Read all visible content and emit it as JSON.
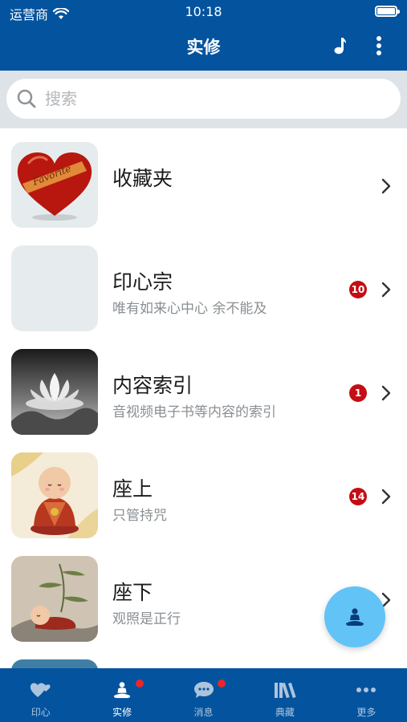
{
  "status": {
    "carrier": "运营商",
    "time": "10:18"
  },
  "nav": {
    "title": "实修",
    "music_icon": "music-note-icon",
    "more_icon": "more-vertical-icon"
  },
  "search": {
    "placeholder": "搜索",
    "value": ""
  },
  "items": [
    {
      "title": "收藏夹",
      "subtitle": "",
      "badge": "",
      "thumb": "favorite-heart"
    },
    {
      "title": "印心宗",
      "subtitle": "唯有如来心中心 余不能及",
      "badge": "10",
      "thumb": "blank"
    },
    {
      "title": "内容索引",
      "subtitle": "音视频电子书等内容的索引",
      "badge": "1",
      "thumb": "lotus"
    },
    {
      "title": "座上",
      "subtitle": "只管持咒",
      "badge": "14",
      "thumb": "monk-sitting"
    },
    {
      "title": "座下",
      "subtitle": "观照是正行",
      "badge": "",
      "thumb": "monk-lying"
    }
  ],
  "tabs": [
    {
      "label": "印心",
      "icon": "hearts-icon",
      "active": false,
      "dot": false
    },
    {
      "label": "实修",
      "icon": "meditation-icon",
      "active": true,
      "dot": true
    },
    {
      "label": "消息",
      "icon": "chat-bubble-icon",
      "active": false,
      "dot": true
    },
    {
      "label": "典藏",
      "icon": "library-books-icon",
      "active": false,
      "dot": false
    },
    {
      "label": "更多",
      "icon": "more-horizontal-icon",
      "active": false,
      "dot": false
    }
  ],
  "favorite_ribbon": "Favorite",
  "colors": {
    "primary": "#04539e",
    "badge": "#c40d14",
    "fab": "#62c3f6",
    "tab_dot": "#e8262b"
  }
}
